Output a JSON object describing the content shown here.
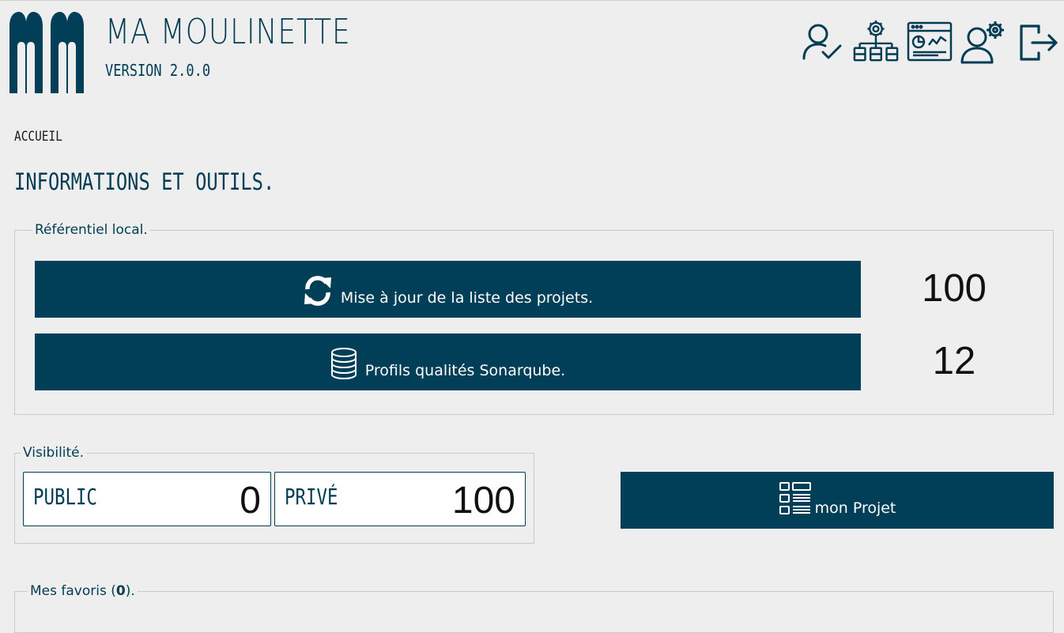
{
  "header": {
    "logo_text": "MM",
    "title": "MA MOULINETTE",
    "version": "VERSION 2.0.0",
    "tools": [
      {
        "name": "user-check-icon"
      },
      {
        "name": "hierarchy-gear-icon"
      },
      {
        "name": "dashboard-window-icon"
      },
      {
        "name": "users-settings-icon"
      },
      {
        "name": "logout-icon"
      }
    ]
  },
  "breadcrumb": "ACCUEIL",
  "page_title": "INFORMATIONS ET OUTILS.",
  "referentiel": {
    "legend": "Référentiel local.",
    "refresh_label": "Mise à jour de la liste des projets.",
    "refresh_count": "100",
    "profiles_label": "Profils qualités Sonarqube.",
    "profiles_count": "12"
  },
  "visibilite": {
    "legend": "Visibilité.",
    "public_label": "PUBLIC",
    "public_value": "0",
    "private_label": "PRIVÉ",
    "private_value": "100"
  },
  "project_button": "mon Projet",
  "favoris": {
    "legend_prefix": "Mes favoris (",
    "count": "0",
    "legend_suffix": ")."
  },
  "colors": {
    "primary": "#003f57",
    "background": "#eeeeee",
    "text": "#003c53"
  }
}
